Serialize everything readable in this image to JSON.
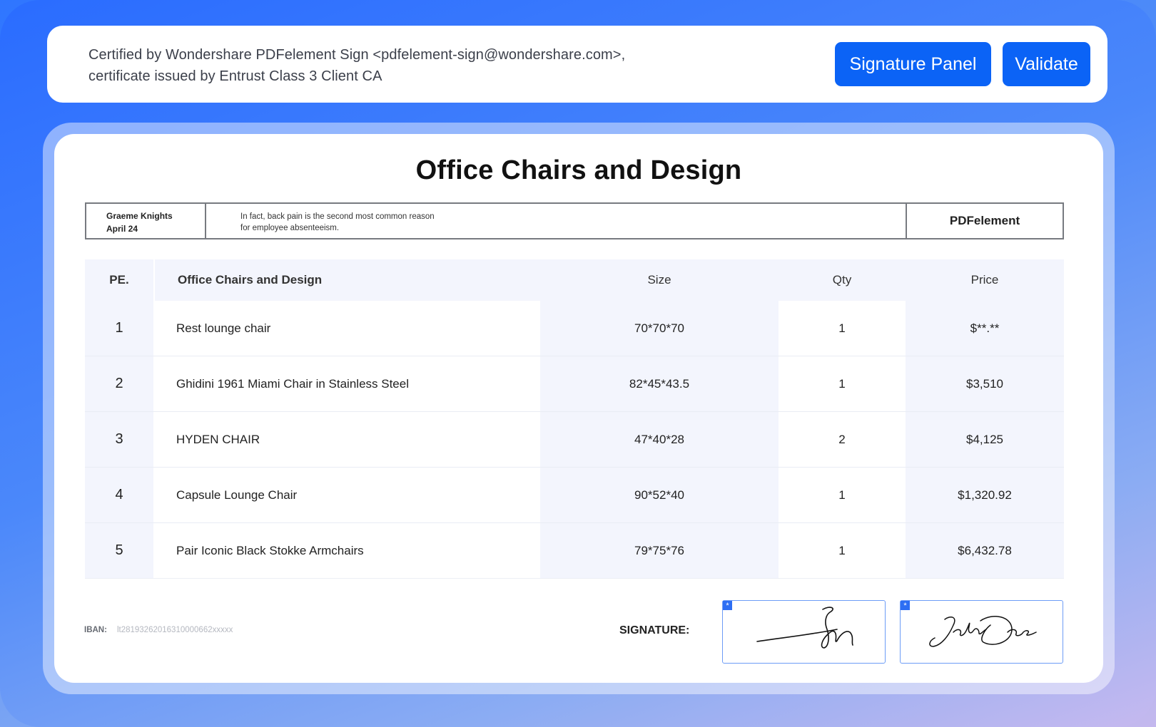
{
  "certificate": {
    "line1": "Certified by Wondershare PDFelement Sign <pdfelement-sign@wondershare.com>,",
    "line2": "certificate issued by Entrust Class 3 Client CA"
  },
  "toolbar": {
    "signature_panel_label": "Signature Panel",
    "validate_label": "Validate"
  },
  "document": {
    "title": "Office Chairs and Design",
    "info": {
      "name": "Graeme Knights",
      "date": "April 24",
      "note_line1": "In fact, back pain is the second most common reason",
      "note_line2": "for employee absenteeism.",
      "brand": "PDFelement"
    },
    "table": {
      "headers": {
        "pe": "PE.",
        "title": "Office Chairs and Design",
        "size": "Size",
        "qty": "Qty",
        "price": "Price"
      },
      "rows": [
        {
          "no": "1",
          "name": "Rest lounge chair",
          "size": "70*70*70",
          "qty": "1",
          "price": "$**.**"
        },
        {
          "no": "2",
          "name": "Ghidini 1961 Miami Chair in Stainless Steel",
          "size": "82*45*43.5",
          "qty": "1",
          "price": "$3,510"
        },
        {
          "no": "3",
          "name": "HYDEN CHAIR",
          "size": "47*40*28",
          "qty": "2",
          "price": "$4,125"
        },
        {
          "no": "4",
          "name": "Capsule Lounge Chair",
          "size": "90*52*40",
          "qty": "1",
          "price": "$1,320.92"
        },
        {
          "no": "5",
          "name": "Pair Iconic Black Stokke Armchairs",
          "size": "79*75*76",
          "qty": "1",
          "price": "$6,432.78"
        }
      ]
    },
    "footer": {
      "iban_label": "IBAN:",
      "iban_value": "lt2819326201631000066​2xxxxx",
      "signature_label": "SIGNATURE:",
      "signature_tag": "*"
    }
  },
  "colors": {
    "accent": "#0b63f6",
    "heading_blue": "#1463ea",
    "cell_tint": "#f3f5fd"
  }
}
